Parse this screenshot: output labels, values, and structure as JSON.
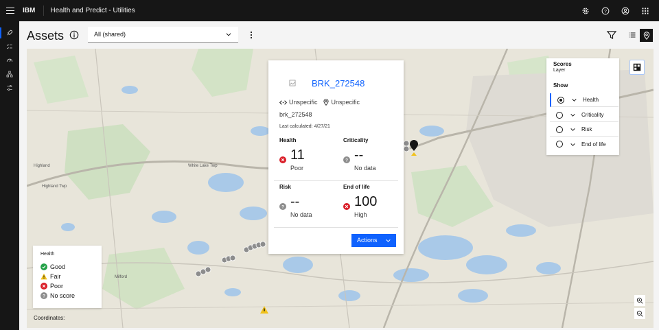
{
  "topbar": {
    "brand": "IBM",
    "app_title": "Health and Predict - Utilities",
    "icons": [
      "settings-icon",
      "help-icon",
      "user-avatar-icon",
      "app-switcher-icon"
    ]
  },
  "sidenav": {
    "items": [
      "rocket-icon",
      "checklist-icon",
      "meter-icon",
      "hierarchy-icon",
      "sliders-icon"
    ]
  },
  "header": {
    "title": "Assets",
    "view_select": "All (shared)"
  },
  "popup": {
    "asset_name": "BRK_272548",
    "location_1": "Unspecific",
    "location_2": "Unspecific",
    "asset_id": "brk_272548",
    "last_calculated": "Last calculated: 4/27/21",
    "scores": {
      "health": {
        "label": "Health",
        "value": "11",
        "status": "Poor"
      },
      "criticality": {
        "label": "Criticality",
        "value": "--",
        "status": "No data"
      },
      "risk": {
        "label": "Risk",
        "value": "--",
        "status": "No data"
      },
      "end_of_life": {
        "label": "End of life",
        "value": "100",
        "status": "High"
      }
    },
    "actions_label": "Actions"
  },
  "layers": {
    "title": "Scores",
    "subtitle": "Layer",
    "show_label": "Show",
    "items": [
      {
        "label": "Health",
        "selected": true
      },
      {
        "label": "Criticality",
        "selected": false
      },
      {
        "label": "Risk",
        "selected": false
      },
      {
        "label": "End of life",
        "selected": false
      }
    ]
  },
  "legend": {
    "title": "Health",
    "items": [
      {
        "label": "Good",
        "color": "#24a148"
      },
      {
        "label": "Fair",
        "color": "#f1c21b"
      },
      {
        "label": "Poor",
        "color": "#da1e28"
      },
      {
        "label": "No score",
        "color": "#8d8d8d"
      }
    ]
  },
  "map": {
    "coordinates_label": "Coordinates:",
    "place_labels": [
      "White Lake Twp",
      "Highland Twp",
      "Highland",
      "Milford"
    ]
  },
  "colors": {
    "accent": "#0f62fe",
    "shell": "#161616"
  }
}
